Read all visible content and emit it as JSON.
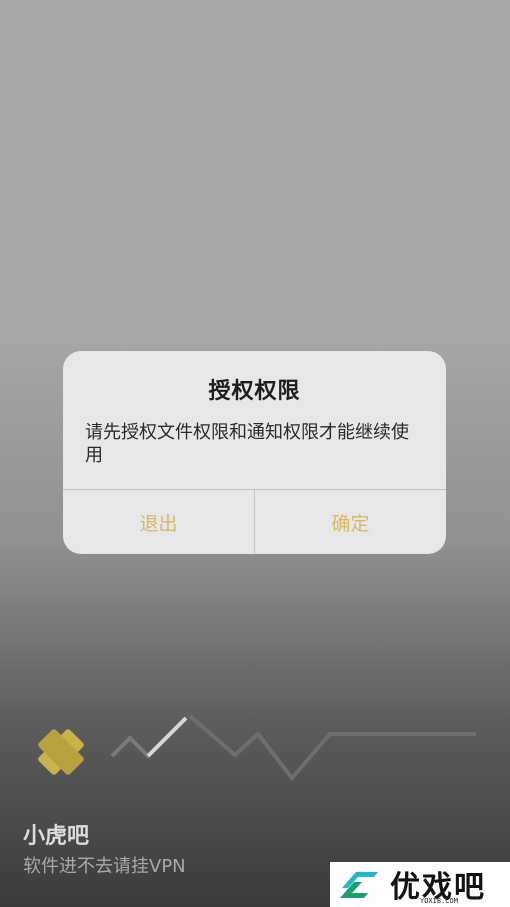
{
  "dialog": {
    "title": "授权权限",
    "message": "请先授权文件权限和通知权限才能继续使用",
    "exit_label": "退出",
    "confirm_label": "确定",
    "accent_color": "#d7b867"
  },
  "app": {
    "name": "小虎吧",
    "subtitle": "软件进不去请挂VPN"
  },
  "watermark": {
    "text": "优戏吧",
    "domain": "YOXI8.COM"
  },
  "icons": [
    "logo-cross-icon",
    "check-icon",
    "zigzag-line",
    "watermark-logo-icon"
  ]
}
